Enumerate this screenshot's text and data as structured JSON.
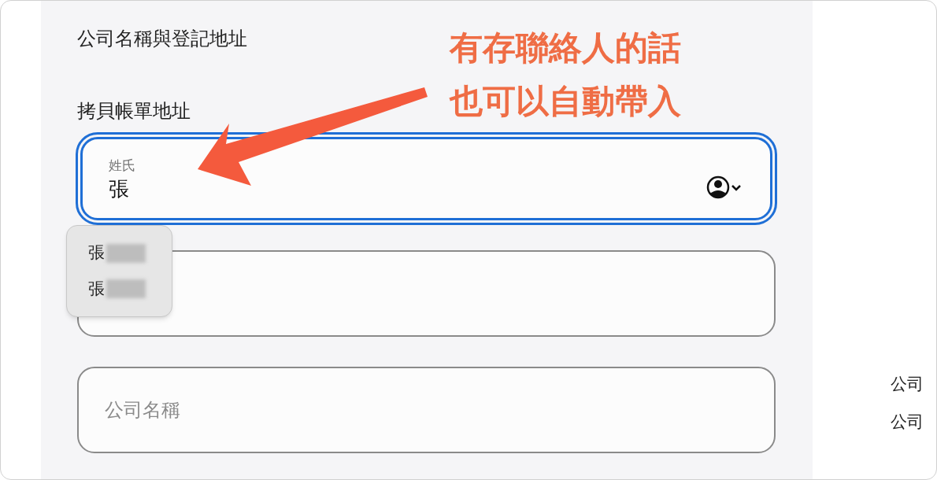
{
  "section_title": "公司名稱與登記地址",
  "copy_billing_label": "拷貝帳單地址",
  "fields": [
    {
      "label": "姓氏",
      "value": "張",
      "focused": true,
      "contact_picker": true
    },
    {
      "focused": false
    },
    {
      "placeholder": "公司名稱",
      "focused": false
    }
  ],
  "autofill_menu": {
    "items": [
      "張",
      "張"
    ]
  },
  "annotation": {
    "lines": [
      "有存聯絡人的話",
      "也可以自動帶入"
    ]
  },
  "side_list": [
    "公司",
    "公司"
  ]
}
